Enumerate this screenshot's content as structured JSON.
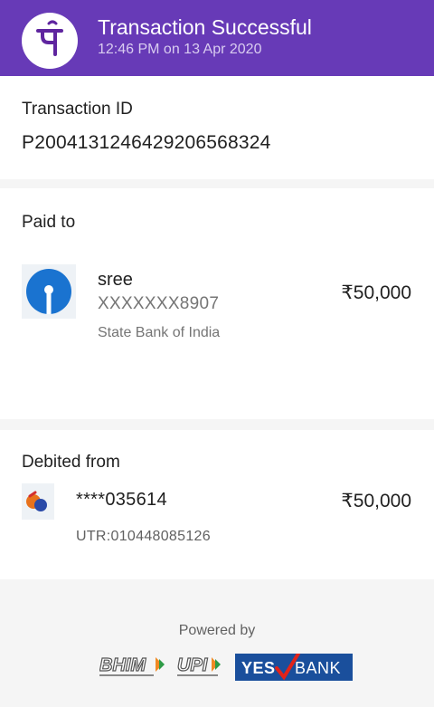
{
  "header": {
    "title": "Transaction Successful",
    "subtitle": "12:46 PM on 13 Apr 2020",
    "logo_glyph": "पे",
    "bg_color": "#673ab7"
  },
  "transaction": {
    "label": "Transaction ID",
    "id": "P2004131246429206568324"
  },
  "paid_to": {
    "label": "Paid to",
    "name": "sree",
    "account": "XXXXXXX8907",
    "bank": "State Bank of India",
    "amount": "₹50,000",
    "icon": "sbi-bank-icon"
  },
  "debited_from": {
    "label": "Debited from",
    "account": "****035614",
    "amount": "₹50,000",
    "utr": "UTR:010448085126",
    "icon": "bank-of-india-icon"
  },
  "footer": {
    "powered_by": "Powered by",
    "bhim_text": "BHIM",
    "upi_text": "UPI",
    "yes_text": "YES",
    "bank_text": "BANK"
  }
}
